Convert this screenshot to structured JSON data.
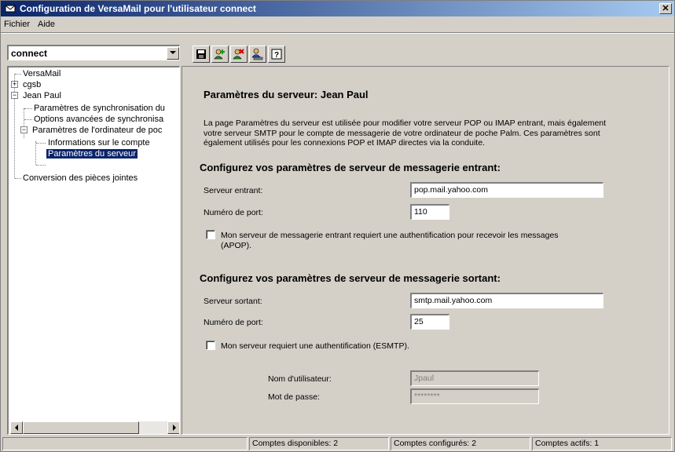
{
  "window": {
    "title": "Configuration de VersaMail pour l'utilisateur connect",
    "close_label": "✕"
  },
  "menu": {
    "items": [
      "Fichier",
      "Aide"
    ]
  },
  "account_selector": {
    "value": "connect"
  },
  "toolbar": {
    "buttons": [
      "save-icon",
      "add-account-icon",
      "delete-account-icon",
      "user-settings-icon",
      "help-icon"
    ]
  },
  "tree": {
    "items": [
      {
        "label": "VersaMail"
      },
      {
        "label": "cgsb",
        "expander": "+"
      },
      {
        "label": "Jean Paul",
        "expander": "−"
      },
      {
        "label": "Paramètres de synchronisation du"
      },
      {
        "label": "Options avancées de synchronisa"
      },
      {
        "label": "Paramètres de l'ordinateur de poc",
        "expander": "−"
      },
      {
        "label": "Informations sur le compte"
      },
      {
        "label": "Paramètres du serveur",
        "selected": true
      },
      {
        "label": "Conversion des pièces jointes"
      }
    ]
  },
  "content": {
    "heading": "Paramètres du serveur: Jean Paul",
    "description": "La page Paramètres du serveur est utilisée pour modifier votre serveur POP ou IMAP entrant, mais également votre serveur SMTP pour le compte de messagerie de votre ordinateur de poche Palm. Ces paramètres sont également utilisés pour les connexions POP et IMAP directes via la conduite.",
    "incoming": {
      "title": "Configurez vos paramètres de serveur de messagerie entrant:",
      "server_label": "Serveur entrant:",
      "server_value": "pop.mail.yahoo.com",
      "port_label": "Numéro de port:",
      "port_value": "110",
      "auth_label": "Mon serveur de messagerie entrant requiert une authentification pour recevoir les messages (APOP).",
      "auth_checked": false
    },
    "outgoing": {
      "title": "Configurez vos paramètres de serveur de messagerie sortant:",
      "server_label": "Serveur sortant:",
      "server_value": "smtp.mail.yahoo.com",
      "port_label": "Numéro de port:",
      "port_value": "25",
      "auth_label": "Mon serveur requiert une authentification (ESMTP).",
      "auth_checked": false,
      "username_label": "Nom d'utilisateur:",
      "username_value": "Jpaul",
      "password_label": "Mot de passe:",
      "password_value": "********"
    }
  },
  "status": {
    "available": "Comptes disponibles: 2",
    "configured": "Comptes configurés: 2",
    "active": "Comptes actifs: 1"
  }
}
